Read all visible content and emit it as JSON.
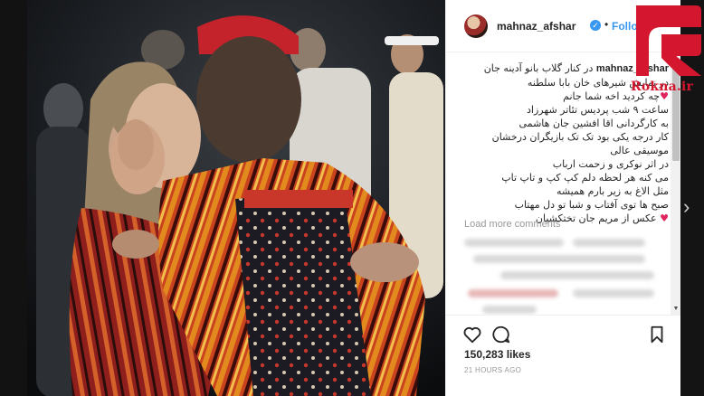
{
  "post": {
    "username": "mahnaz_afshar",
    "verified_icon": "verified-badge-icon",
    "separator": "•",
    "follow_label": "Follow",
    "caption_author": "mahnaz_afshar",
    "caption_lines": [
      "در کنار گلاب بانو آدینه جان",
      "در نمایش شیرهای خان بابا سلطنه",
      "چه کردید اخه شما جانم",
      "ساعت ۹ شب پردیس تئاتر شهرزاد",
      "به کارگردانی اقا افشین جان هاشمی",
      "کار درجه یکی بود تک تک بازیگران درخشان",
      "موسیقی عالی",
      "در اثر نوکری و زحمت ارباب",
      "می کنه هر لحظه دلم کپ کپ و تاپ تاپ",
      "مثل الاغ به زیر بارم همیشه",
      "صبح ها توی آفتاب و شبا تو دل مهتاب",
      "عکس از مریم جان تختکشیان"
    ],
    "load_more": "Load more comments",
    "likes": "150,283 likes",
    "time_ago": "21 HOURS AGO"
  },
  "icons": {
    "like": "heart-icon",
    "comment": "comment-icon",
    "bookmark": "bookmark-icon",
    "scroll_up": "scroll-up-arrow-icon",
    "scroll_down": "scroll-down-arrow-icon",
    "next": "chevron-right-icon"
  },
  "colors": {
    "link_blue": "#3897f0",
    "text": "#262626",
    "muted": "#999999",
    "logo_red": "#d4172f"
  },
  "watermark": {
    "text": "Rokna.ir"
  }
}
